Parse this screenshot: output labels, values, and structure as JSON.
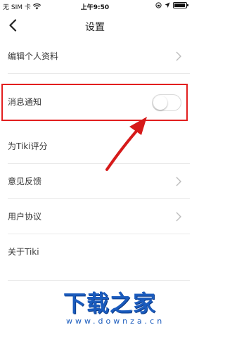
{
  "status_bar": {
    "carrier": "无 SIM 卡",
    "time": "上午9:50",
    "wifi_icon": "wifi-icon",
    "battery_icon": "battery-icon"
  },
  "nav": {
    "back_icon": "chevron-left-icon",
    "title": "设置"
  },
  "settings": {
    "items": [
      {
        "label": "编辑个人资料",
        "has_chevron": true
      },
      {
        "label": "消息通知",
        "toggle": false
      },
      {
        "label": "为Tiki评分",
        "has_chevron": false
      },
      {
        "label": "意见反馈",
        "has_chevron": true
      },
      {
        "label": "用户协议",
        "has_chevron": true
      },
      {
        "label": "关于Tiki",
        "has_chevron": false
      }
    ]
  },
  "annotation": {
    "highlight_color": "#e21f1f",
    "arrow_color": "#d61a1a"
  },
  "watermark": {
    "title": "下载之家",
    "url": "www.downza.cn",
    "color": "#1a5bbd"
  }
}
